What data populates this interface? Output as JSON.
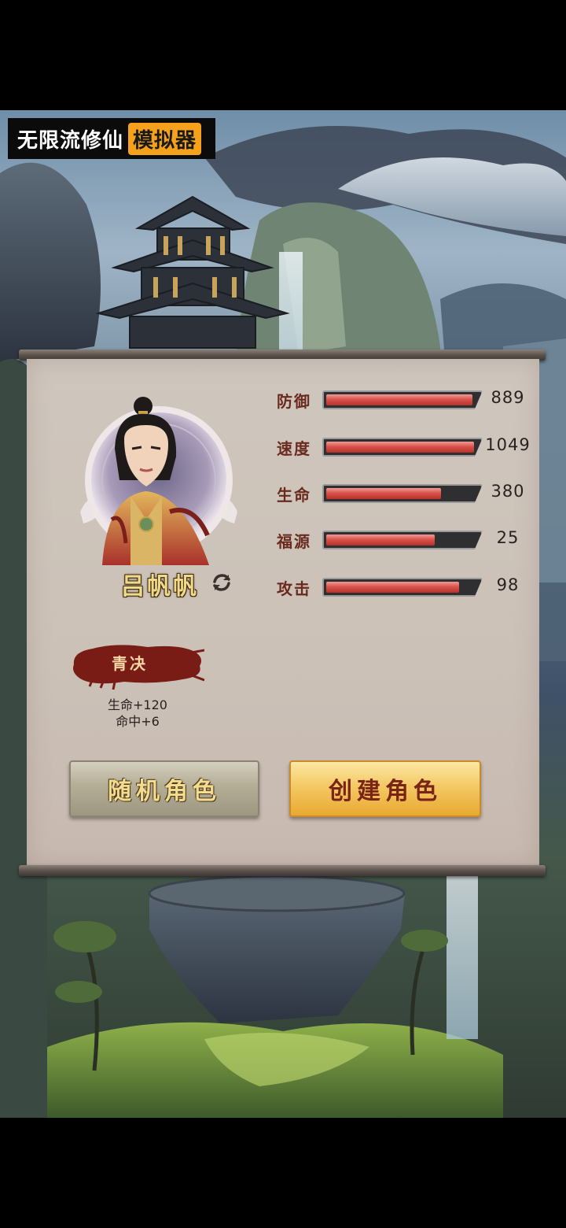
{
  "app": {
    "title": "无限流修仙",
    "tag": "模拟器"
  },
  "character": {
    "name": "吕帆帆",
    "refresh_icon": "refresh-icon"
  },
  "stats": [
    {
      "label": "防御",
      "value": "889",
      "fill": 0.96
    },
    {
      "label": "速度",
      "value": "1049",
      "fill": 0.97
    },
    {
      "label": "生命",
      "value": "380",
      "fill": 0.75
    },
    {
      "label": "福源",
      "value": "25",
      "fill": 0.71
    },
    {
      "label": "攻击",
      "value": "98",
      "fill": 0.87
    }
  ],
  "trait": {
    "name": "青决",
    "effects": [
      "生命+120",
      "命中+6"
    ]
  },
  "buttons": {
    "random": "随机角色",
    "create": "创建角色"
  },
  "colors": {
    "accent": "#f5a11c",
    "bar_fill": "#d9544c",
    "label": "#6a2a1e"
  }
}
